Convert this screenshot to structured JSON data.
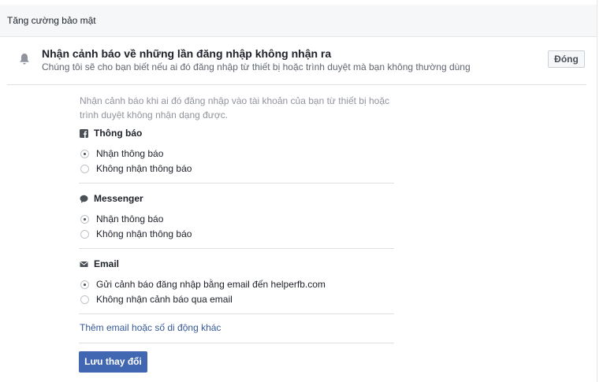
{
  "panel": {
    "title": "Tăng cường bảo mật"
  },
  "section": {
    "icon": "bell-icon",
    "title": "Nhận cảnh báo về những lần đăng nhập không nhận ra",
    "description": "Chúng tôi sẽ cho bạn biết nếu ai đó đăng nhập từ thiết bị hoặc trình duyệt mà bạn không thường dùng",
    "close_label": "Đóng"
  },
  "intro": "Nhận cảnh báo khi ai đó đăng nhập vào tài khoản của bạn từ thiết bị hoặc trình duyệt không nhận dạng được.",
  "groups": [
    {
      "icon": "facebook-icon",
      "title": "Thông báo",
      "options": [
        {
          "label": "Nhận thông báo",
          "selected": true
        },
        {
          "label": "Không nhận thông báo",
          "selected": false
        }
      ]
    },
    {
      "icon": "messenger-icon",
      "title": "Messenger",
      "options": [
        {
          "label": "Nhận thông báo",
          "selected": true
        },
        {
          "label": "Không nhận thông báo",
          "selected": false
        }
      ]
    },
    {
      "icon": "email-icon",
      "title": "Email",
      "options": [
        {
          "label": "Gửi cảnh báo đăng nhập bằng email đến helperfb.com",
          "selected": true
        },
        {
          "label": "Không nhận cảnh báo qua email",
          "selected": false
        }
      ]
    }
  ],
  "add_contact_link": "Thêm email hoặc số di động khác",
  "save_label": "Lưu thay đổi",
  "colors": {
    "accent": "#4267b2",
    "link": "#365899",
    "muted_text": "#90949c"
  }
}
